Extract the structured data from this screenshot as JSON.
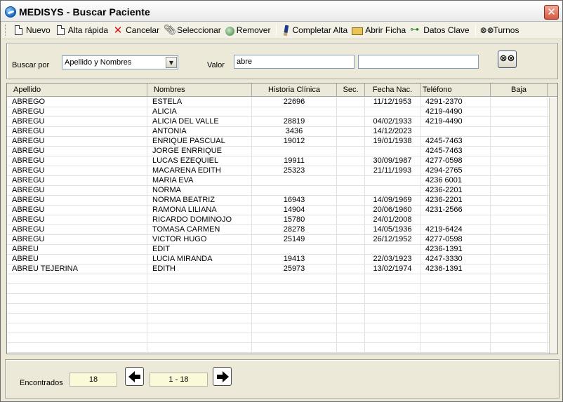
{
  "window": {
    "title": "MEDISYS - Buscar Paciente",
    "close_label": "✕"
  },
  "toolbar": {
    "nuevo": "Nuevo",
    "alta_rapida": "Alta rápida",
    "cancelar": "Cancelar",
    "seleccionar": "Seleccionar",
    "remover": "Remover",
    "completar_alta": "Completar Alta",
    "abrir_ficha": "Abrir Ficha",
    "datos_clave": "Datos Clave",
    "turnos": "Turnos"
  },
  "search": {
    "buscar_por_label": "Buscar por",
    "buscar_por_value": "Apellido y Nombres",
    "valor_label": "Valor",
    "valor_value": "abre",
    "valor2_value": ""
  },
  "grid": {
    "columns": [
      "Apellido",
      "Nombres",
      "Historia Clínica",
      "Sec.",
      "Fecha Nac.",
      "Teléfono",
      "Baja"
    ],
    "rows": [
      [
        "ABREGO",
        "ESTELA",
        "22696",
        "",
        "11/12/1953",
        "4291-2370",
        ""
      ],
      [
        "ABREGU",
        "ALICIA",
        "",
        "",
        "",
        "4219-4490",
        ""
      ],
      [
        "ABREGU",
        "ALICIA DEL VALLE",
        "28819",
        "",
        "04/02/1933",
        "4219-4490",
        ""
      ],
      [
        "ABREGU",
        "ANTONIA",
        "3436",
        "",
        "14/12/2023",
        "",
        ""
      ],
      [
        "ABREGU",
        "ENRIQUE PASCUAL",
        "19012",
        "",
        "19/01/1938",
        "4245-7463",
        ""
      ],
      [
        "ABREGU",
        "JORGE ENRRIQUE",
        "",
        "",
        "",
        "4245-7463",
        ""
      ],
      [
        "ABREGU",
        "LUCAS EZEQUIEL",
        "19911",
        "",
        "30/09/1987",
        "4277-0598",
        ""
      ],
      [
        "ABREGU",
        "MACARENA EDITH",
        "25323",
        "",
        "21/11/1993",
        "4294-2765",
        ""
      ],
      [
        "ABREGU",
        "MARIA EVA",
        "",
        "",
        "",
        "4236 6001",
        ""
      ],
      [
        "ABREGU",
        "NORMA",
        "",
        "",
        "",
        "4236-2201",
        ""
      ],
      [
        "ABREGU",
        "NORMA BEATRIZ",
        "16943",
        "",
        "14/09/1969",
        "4236-2201",
        ""
      ],
      [
        "ABREGU",
        "RAMONA LILIANA",
        "14904",
        "",
        "20/06/1960",
        "4231-2566",
        ""
      ],
      [
        "ABREGU",
        "RICARDO DOMINOJO",
        "15780",
        "",
        "24/01/2008",
        "",
        ""
      ],
      [
        "ABREGU",
        "TOMASA CARMEN",
        "28278",
        "",
        "14/05/1936",
        "4219-6424",
        ""
      ],
      [
        "ABREGU",
        "VICTOR HUGO",
        "25149",
        "",
        "26/12/1952",
        "4277-0598",
        ""
      ],
      [
        "ABREU",
        "EDIT",
        "",
        "",
        "",
        "4236-1391",
        ""
      ],
      [
        "ABREU",
        "LUCIA MIRANDA",
        "19413",
        "",
        "22/03/1923",
        "4247-3330",
        ""
      ],
      [
        "ABREU TEJERINA",
        "EDITH",
        "25973",
        "",
        "13/02/1974",
        "4236-1391",
        ""
      ]
    ],
    "empty_rows": 8
  },
  "footer": {
    "encontrados_label": "Encontrados",
    "encontrados_value": "18",
    "page_range": "1 - 18"
  }
}
